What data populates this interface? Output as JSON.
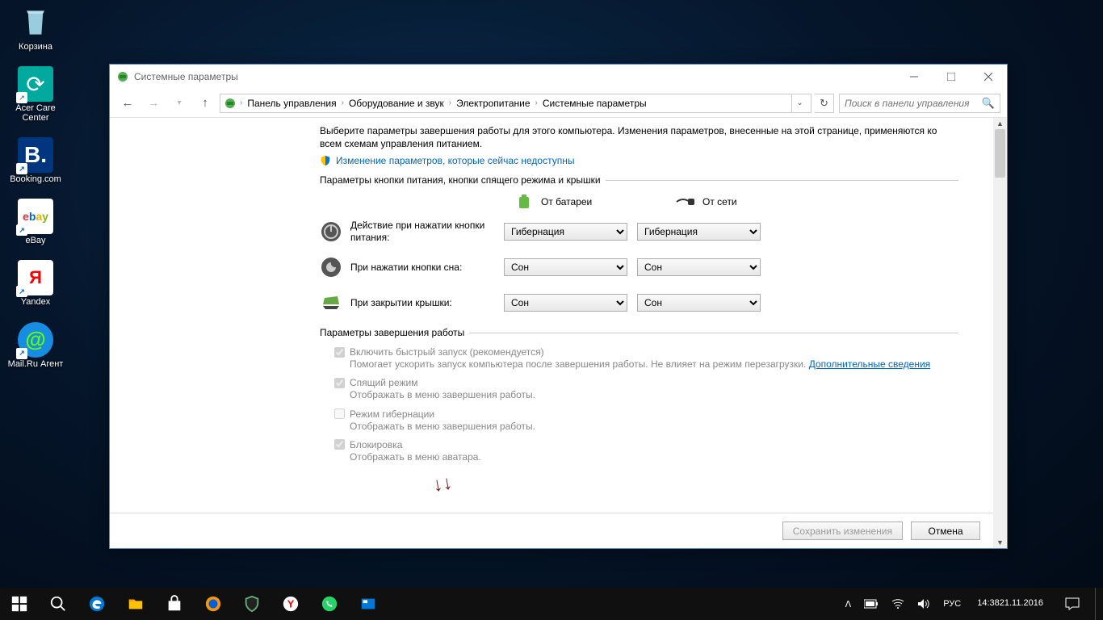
{
  "desktop": {
    "icons": [
      {
        "label": "Корзина"
      },
      {
        "label": "Acer Care Center"
      },
      {
        "label": "Booking.com"
      },
      {
        "label": "eBay"
      },
      {
        "label": "Yandex"
      },
      {
        "label": "Mail.Ru Агент"
      }
    ]
  },
  "window": {
    "title": "Системные параметры",
    "breadcrumbs": [
      "Панель управления",
      "Оборудование и звук",
      "Электропитание",
      "Системные параметры"
    ],
    "search_placeholder": "Поиск в панели управления",
    "intro": "Выберите параметры завершения работы для этого компьютера. Изменения параметров, внесенные на этой странице, применяются ко всем схемам управления питанием.",
    "shield_link": "Изменение параметров, которые сейчас недоступны",
    "section_buttons_title": "Параметры кнопки питания, кнопки спящего режима и крышки",
    "col_battery": "От батареи",
    "col_ac": "От сети",
    "rows": [
      {
        "label": "Действие при нажатии кнопки питания:",
        "battery": "Гибернация",
        "ac": "Гибернация"
      },
      {
        "label": "При нажатии кнопки сна:",
        "battery": "Сон",
        "ac": "Сон"
      },
      {
        "label": "При закрытии крышки:",
        "battery": "Сон",
        "ac": "Сон"
      }
    ],
    "section_shutdown_title": "Параметры завершения работы",
    "opts": {
      "fast": {
        "label": "Включить быстрый запуск (рекомендуется)",
        "desc_pre": "Помогает ускорить запуск компьютера после завершения работы. Не влияет на режим перезагрузки. ",
        "link": "Дополнительные сведения"
      },
      "sleep": {
        "label": "Спящий режим",
        "desc": "Отображать в меню завершения работы."
      },
      "hiber": {
        "label": "Режим гибернации",
        "desc": "Отображать в меню завершения работы."
      },
      "lock": {
        "label": "Блокировка",
        "desc": "Отображать в меню аватара."
      }
    },
    "btn_save": "Сохранить изменения",
    "btn_cancel": "Отмена"
  },
  "taskbar": {
    "lang": "РУС",
    "time": "14:38",
    "date": "21.11.2016"
  }
}
